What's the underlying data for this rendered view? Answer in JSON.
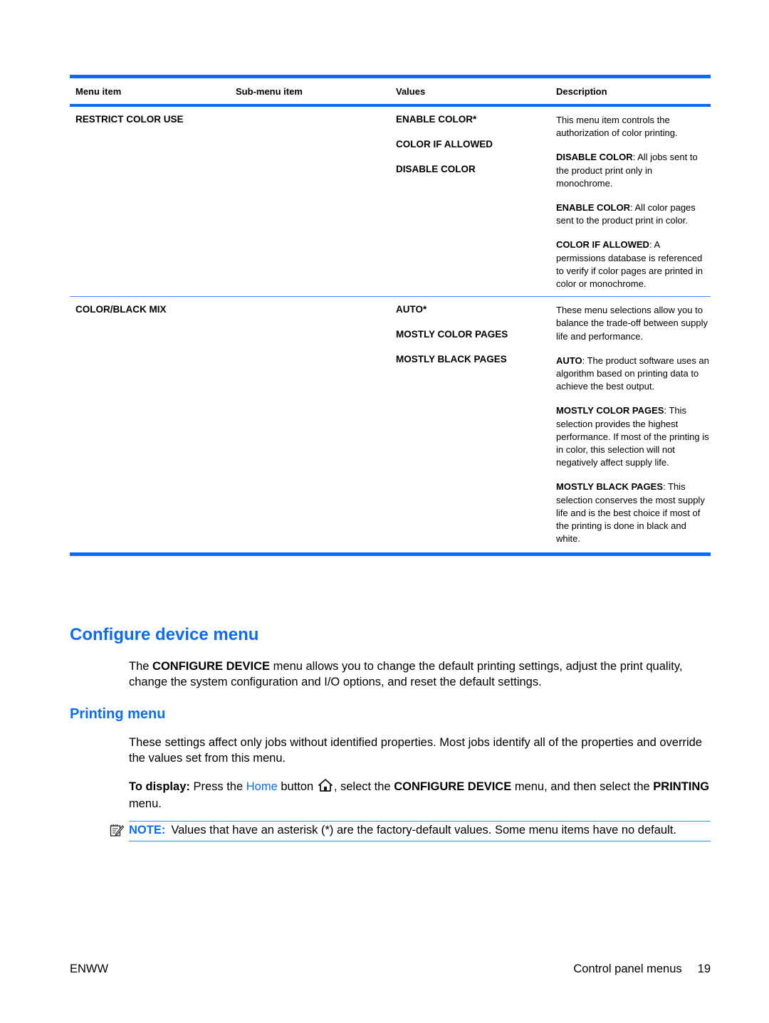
{
  "table": {
    "headers": [
      "Menu item",
      "Sub-menu item",
      "Values",
      "Description"
    ],
    "rows": [
      {
        "menu_item": "RESTRICT COLOR USE",
        "sub_menu_item": "",
        "values": [
          "ENABLE COLOR*",
          "COLOR IF ALLOWED",
          "DISABLE COLOR"
        ],
        "description": [
          {
            "bold": "",
            "text": "This menu item controls the authorization of color printing."
          },
          {
            "bold": "DISABLE COLOR",
            "text": ": All jobs sent to the product print only in monochrome."
          },
          {
            "bold": "ENABLE COLOR",
            "text": ": All color pages sent to the product print in color."
          },
          {
            "bold": "COLOR IF ALLOWED",
            "text": ": A permissions database is referenced to verify if color pages are printed in color or monochrome."
          }
        ]
      },
      {
        "menu_item": "COLOR/BLACK MIX",
        "sub_menu_item": "",
        "values": [
          "AUTO*",
          "MOSTLY COLOR PAGES",
          "MOSTLY BLACK PAGES"
        ],
        "description": [
          {
            "bold": "",
            "text": "These menu selections allow you to balance the trade-off between supply life and performance."
          },
          {
            "bold": "AUTO",
            "text": ": The product software uses an algorithm based on printing data to achieve the best output."
          },
          {
            "bold": "MOSTLY COLOR PAGES",
            "text": ": This selection provides the highest performance. If most of the printing is in color, this selection will not negatively affect supply life."
          },
          {
            "bold": "MOSTLY BLACK PAGES",
            "text": ": This selection conserves the most supply life and is the best choice if most of the printing is done in black and white."
          }
        ]
      }
    ]
  },
  "section": {
    "title": "Configure device menu",
    "intro_pre": "The ",
    "intro_bold": "CONFIGURE DEVICE",
    "intro_post": " menu allows you to change the default printing settings, adjust the print quality, change the system configuration and I/O options, and reset the default settings."
  },
  "subsection": {
    "title": "Printing menu",
    "para": "These settings affect only jobs without identified properties. Most jobs identify all of the properties and override the values set from this menu.",
    "display_label": "To display:",
    "display_1": " Press the ",
    "display_link": "Home",
    "display_2": " button ",
    "display_3": ", select the ",
    "display_bold1": "CONFIGURE DEVICE",
    "display_4": " menu, and then select the ",
    "display_bold2": "PRINTING",
    "display_5": " menu."
  },
  "note": {
    "label": "NOTE:",
    "text": "Values that have an asterisk (*) are the factory-default values. Some menu items have no default."
  },
  "footer": {
    "left": "ENWW",
    "right": "Control panel menus",
    "page": "19"
  },
  "colors": {
    "accent": "#0a6cf5"
  }
}
